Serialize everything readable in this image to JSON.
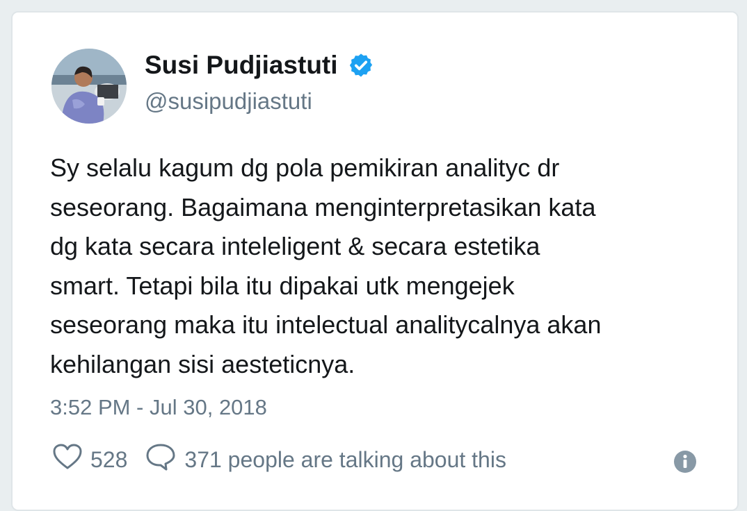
{
  "tweet": {
    "author": {
      "display_name": "Susi Pudjiastuti",
      "handle": "@susipudjiastuti",
      "verified": true,
      "avatar_icon": "profile-photo"
    },
    "text": "Sy selalu kagum dg pola pemikiran analityc dr\nseseorang. Bagaimana menginterpretasikan kata\ndg kata secara inteleligent & secara estetika\nsmart. Tetapi bila itu dipakai utk mengejek\nseseorang maka itu intelectual analitycalnya akan\nkehilangan sisi aesteticnya.",
    "timestamp": "3:52 PM - Jul 30, 2018",
    "likes": "528",
    "conversation": "371 people are talking about this"
  },
  "icons": {
    "verified": "verified-badge-icon",
    "like": "heart-icon",
    "reply": "speech-bubble-icon",
    "info": "info-icon"
  },
  "colors": {
    "verified_blue": "#1da1f2",
    "text_primary": "#14171a",
    "text_secondary": "#657786"
  }
}
